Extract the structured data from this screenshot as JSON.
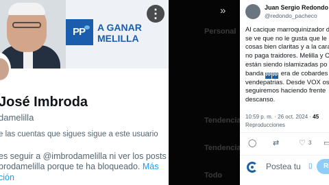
{
  "left_profile": {
    "menu_glyph": "⋮",
    "banner": {
      "party_logo_text": "PP",
      "slogan_line1": "A GANAR",
      "slogan_line2": "MELILLA",
      "brand_color": "#1a5dad"
    },
    "name": "José Imbroda",
    "handle": "@imbrodamelilla",
    "handle_visible": "damelilla",
    "followers_note": "e las cuentas que sigues sigue a este usuario",
    "blocked_line1": "es seguir a @imbrodamelilla ni ver los posts",
    "blocked_line2_prefix": "brodamelilla porque te ha bloqueado.",
    "blocked_more": "Más",
    "blocked_line3": "ción"
  },
  "middle_panel": {
    "chevron": "»",
    "dim_items": [
      "Personal",
      "Tendencias",
      "Tendencia",
      "Todo"
    ]
  },
  "tweet": {
    "author_name": "Juan Sergio Redondo Pacheco",
    "author_name_visible": "Juan Sergio Redondo Pa",
    "author_handle": "@redondo_pacheco",
    "body_lines": [
      "Al cacique marroquinizador d",
      "se ve que no le gusta que le d",
      "cosas bien claritas y a la cara",
      "no paga traidores. Melilla y C",
      "están siendo islamizadas po"
    ],
    "body_line6_prefix": "banda",
    "party_chip": "PP",
    "body_line6_suffix": "era de cobardes",
    "body_lines_tail": [
      "vendepatrias. Desde VOX os",
      "seguiremos haciendo frente",
      "descanso."
    ],
    "timestamp": "10:59 p. m. · 26 oct. 2024 ·",
    "views": "45",
    "reproductions_label": "Reproducciones",
    "actions": {
      "reply_glyph": "◯",
      "retweet_glyph": "⇄",
      "like_glyph": "♡",
      "like_count": "3",
      "bookmark_glyph": "▭"
    },
    "reply_placeholder": "Postea tu",
    "reply_button": "Re"
  }
}
